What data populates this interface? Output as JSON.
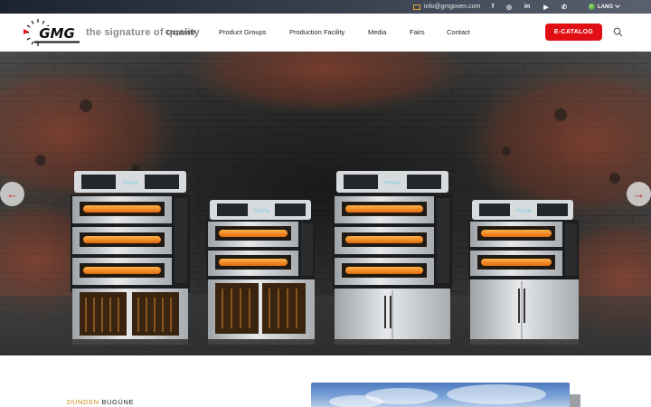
{
  "topbar": {
    "email": "info@gmgoven.com",
    "socials": [
      {
        "icon": "facebook-icon",
        "glyph": "f"
      },
      {
        "icon": "instagram-icon",
        "glyph": "◎"
      },
      {
        "icon": "linkedin-icon",
        "glyph": "in"
      },
      {
        "icon": "youtube-icon",
        "glyph": "▶"
      },
      {
        "icon": "whatsapp-icon",
        "glyph": "✆"
      }
    ],
    "lang_label": "LANG"
  },
  "header": {
    "logo_text": "GMG",
    "slogan": "the signature of quality",
    "menu": [
      "Corporate",
      "Product Groups",
      "Production Facility",
      "Media",
      "Fairs",
      "Contact"
    ],
    "catalog_button": "E-CATALOG"
  },
  "hero": {
    "oven_brand": "nova",
    "prev_arrow": "←",
    "next_arrow": "→",
    "colors": {
      "accent": "#e10f14",
      "glow": "#ff8a1a",
      "steel": "#c9ccd0"
    }
  },
  "section": {
    "ribbon_gold": "DÜNDEN ",
    "ribbon_dark": "BUGÜNE"
  }
}
